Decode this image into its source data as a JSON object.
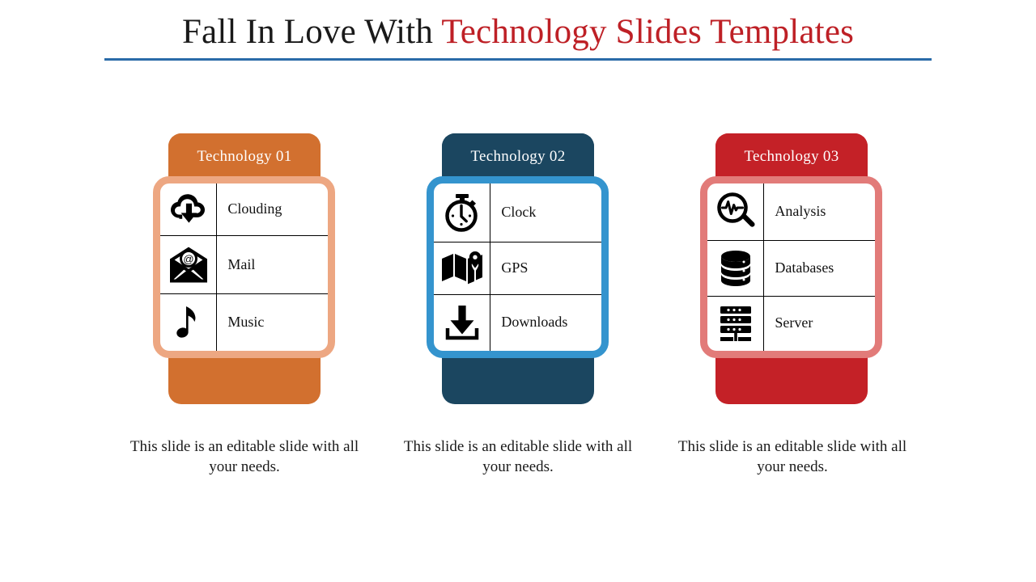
{
  "title": {
    "lead": "Fall In Love With ",
    "accent": "Technology Slides Templates",
    "rule_color": "#2a6ba8",
    "accent_color": "#be2026"
  },
  "cards": [
    {
      "header": "Technology 01",
      "body_color": "#d2702f",
      "border_color": "#eda782",
      "rows": [
        {
          "icon": "cloud-download-icon",
          "label": "Clouding"
        },
        {
          "icon": "mail-at-icon",
          "label": "Mail"
        },
        {
          "icon": "music-note-icon",
          "label": "Music"
        }
      ],
      "caption": "This slide is an editable slide with all your needs."
    },
    {
      "header": "Technology 02",
      "body_color": "#1b4660",
      "border_color": "#3494ce",
      "rows": [
        {
          "icon": "stopwatch-icon",
          "label": "Clock"
        },
        {
          "icon": "map-pin-icon",
          "label": "GPS"
        },
        {
          "icon": "download-tray-icon",
          "label": "Downloads"
        }
      ],
      "caption": "This slide is an editable slide with all your needs."
    },
    {
      "header": "Technology 03",
      "body_color": "#c42127",
      "border_color": "#e27b79",
      "rows": [
        {
          "icon": "analysis-magnifier-icon",
          "label": "Analysis"
        },
        {
          "icon": "database-icon",
          "label": "Databases"
        },
        {
          "icon": "server-rack-icon",
          "label": "Server"
        }
      ],
      "caption": "This slide is an editable slide with all your needs."
    }
  ]
}
